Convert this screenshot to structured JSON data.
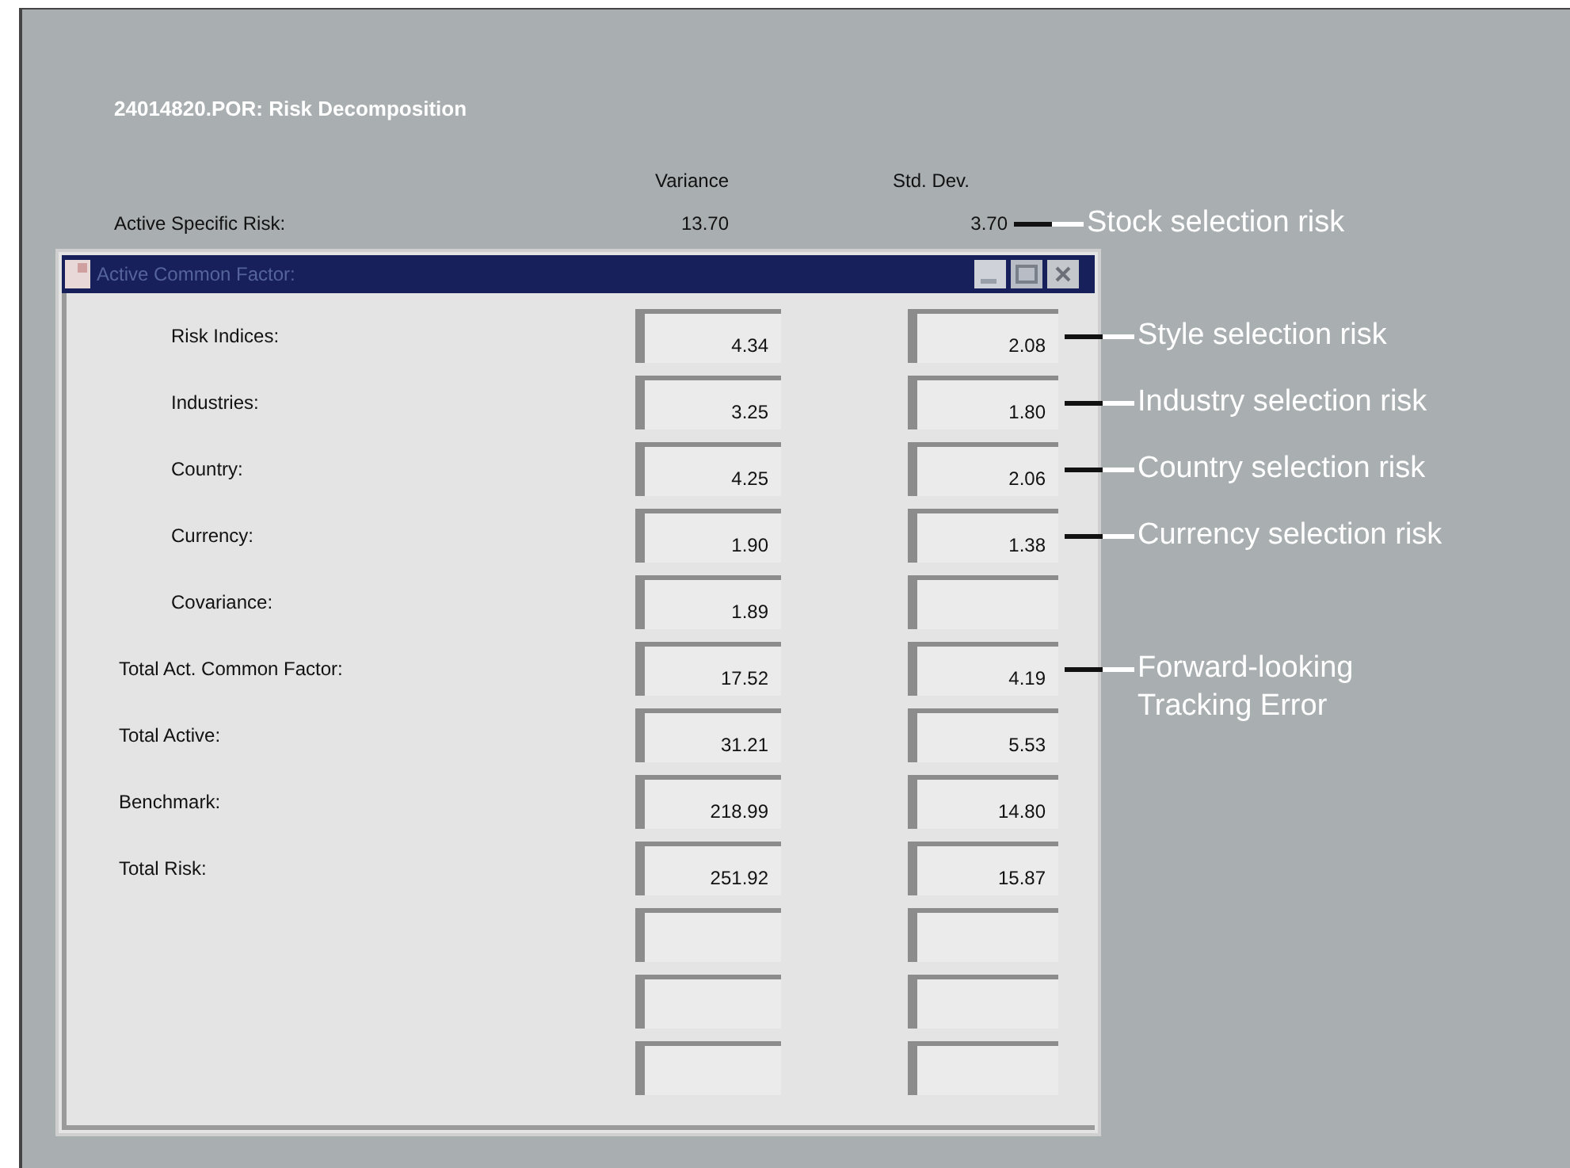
{
  "title": "24014820.POR: Risk Decomposition",
  "columns": [
    "Variance",
    "Std. Dev."
  ],
  "specific_row": {
    "label": "Active Specific Risk:",
    "variance": "13.70",
    "std_dev": "3.70",
    "annotation": "Stock selection risk"
  },
  "window": {
    "title": "Active Common Factor:",
    "components": [
      {
        "label": "Risk Indices:",
        "variance": "4.34",
        "std_dev": "2.08",
        "annotation": "Style selection risk"
      },
      {
        "label": "Industries:",
        "variance": "3.25",
        "std_dev": "1.80",
        "annotation": "Industry selection risk"
      },
      {
        "label": "Country:",
        "variance": "4.25",
        "std_dev": "2.06",
        "annotation": "Country selection risk"
      },
      {
        "label": "Currency:",
        "variance": "1.90",
        "std_dev": "1.38",
        "annotation": "Currency selection risk"
      },
      {
        "label": "Covariance:",
        "variance": "1.89"
      }
    ],
    "totals": [
      {
        "label": "Total Act. Common Factor:",
        "variance": "17.52",
        "std_dev": "4.19",
        "annotation": "Forward-looking\nTracking Error"
      },
      {
        "label": "Total Active:",
        "variance": "31.21",
        "std_dev": "5.53"
      },
      {
        "label": "Benchmark:",
        "variance": "218.99",
        "std_dev": "14.80"
      },
      {
        "label": "Total Risk:",
        "variance": "251.92",
        "std_dev": "15.87"
      }
    ]
  }
}
